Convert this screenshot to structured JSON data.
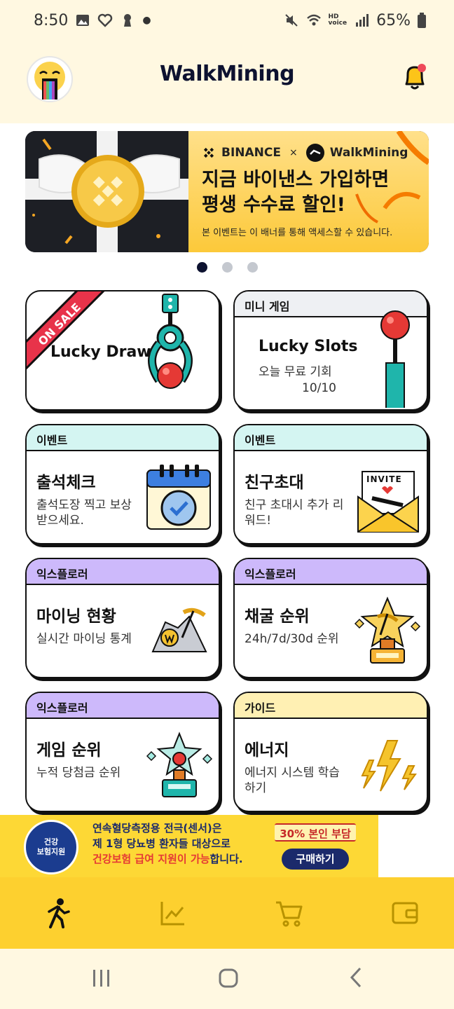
{
  "status_bar": {
    "time": "8:50",
    "battery": "65%",
    "hd_label": "HD",
    "voice_label": "voice"
  },
  "header": {
    "title": "WalkMining"
  },
  "banner": {
    "brand_left": "BINANCE",
    "separator": "×",
    "brand_right": "WalkMining",
    "title_line1": "지금 바이낸스 가입하면",
    "title_line2": "평생 수수료 할인!",
    "note": "본 이벤트는 이 배너를 통해 액세스할 수 있습니다.",
    "page_index": 1,
    "page_count": 3
  },
  "cards": {
    "lucky_draw": {
      "ribbon": "ON SALE",
      "title": "Lucky Draw"
    },
    "lucky_slots": {
      "tag": "미니 게임",
      "title": "Lucky Slots",
      "desc": "오늘 무료 기회",
      "count": "10/10"
    },
    "attendance": {
      "tag": "이벤트",
      "title": "출석체크",
      "desc": "출석도장 찍고 보상 받으세요."
    },
    "invite": {
      "tag": "이벤트",
      "title": "친구초대",
      "desc": "친구 초대시 추가 리워드!",
      "card_word": "INVITE"
    },
    "mining_status": {
      "tag": "익스플로러",
      "title": "마이닝 현황",
      "desc": "실시간 마이닝 통계"
    },
    "mining_rank": {
      "tag": "익스플로러",
      "title": "채굴 순위",
      "desc": "24h/7d/30d 순위"
    },
    "game_rank": {
      "tag": "익스플로러",
      "title": "게임 순위",
      "desc": "누적 당첨금 순위"
    },
    "energy": {
      "tag": "가이드",
      "title": "에너지",
      "desc": "에너지 시스템 학습하기"
    }
  },
  "ad": {
    "seal_line1": "건강",
    "seal_line2": "보험지원",
    "line1": "연속혈당측정용 전극(센서)은",
    "line2": "제 1형 당뇨병 환자들 대상으로",
    "line3_red": "건강보험 급여 지원이 가능",
    "line3_rest": "합니다.",
    "badge": "30% 본인 부담",
    "buy": "구매하기"
  },
  "nav": {
    "items": [
      "walk-icon",
      "chart-icon",
      "cart-icon",
      "wallet-icon"
    ],
    "active": "walk-icon"
  },
  "colors": {
    "header_bg": "#fff8e1",
    "nav_bg": "#fdd02f",
    "title_navy": "#0d1230",
    "tag_mint": "#d4f5f2",
    "tag_purple": "#cdb9fb",
    "tag_yellow": "#fff0b3",
    "tag_gray": "#eef0f3"
  }
}
